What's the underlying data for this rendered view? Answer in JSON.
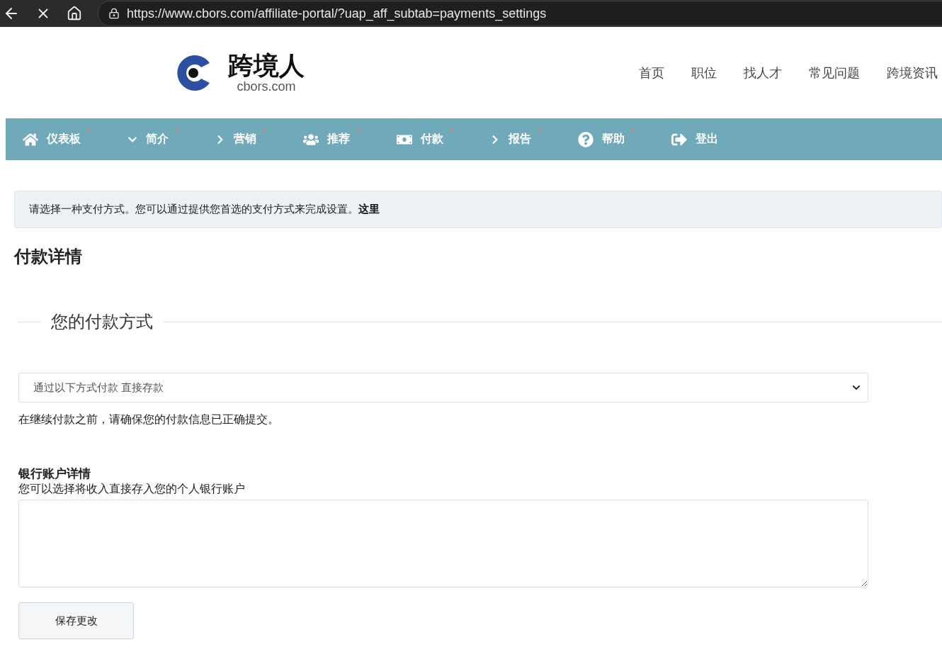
{
  "browser": {
    "url": "https://www.cbors.com/affiliate-portal/?uap_aff_subtab=payments_settings"
  },
  "header": {
    "logo_title": "跨境人",
    "logo_domain": "cbors.com",
    "links": [
      "首页",
      "职位",
      "找人才",
      "常见问题",
      "跨境资讯"
    ]
  },
  "nav": [
    {
      "label": "仪表板",
      "kind": "home",
      "dot": true
    },
    {
      "label": "简介",
      "kind": "down",
      "dot": true
    },
    {
      "label": "营销",
      "kind": "right",
      "dot": true
    },
    {
      "label": "推荐",
      "kind": "users",
      "dot": true
    },
    {
      "label": "付款",
      "kind": "money",
      "dot": true
    },
    {
      "label": "报告",
      "kind": "right",
      "dot": true
    },
    {
      "label": "帮助",
      "kind": "help",
      "dot": true
    },
    {
      "label": "登出",
      "kind": "logout",
      "dot": false
    }
  ],
  "notice": {
    "text": "请选择一种支付方式。您可以通过提供您首选的支付方式来完成设置。",
    "link": "这里"
  },
  "page_title": "付款详情",
  "section": {
    "legend": "您的付款方式",
    "select_value": "通过以下方式付款 直接存款",
    "note": "在继续付款之前，请确保您的付款信息已正确提交。",
    "bank_title": "银行账户详情",
    "bank_desc": "您可以选择将收入直接存入您的个人银行账户",
    "save_button": "保存更改"
  }
}
